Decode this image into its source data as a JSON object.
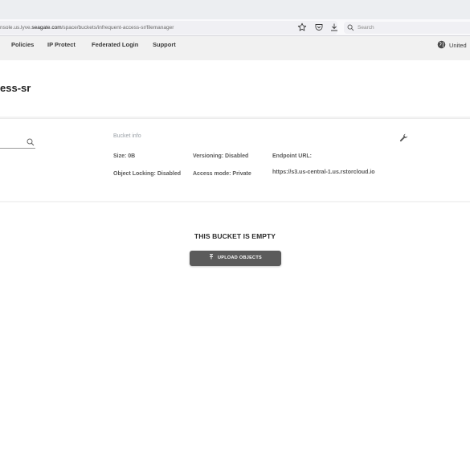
{
  "browser": {
    "url_prefix": "nsole.us.lyve.",
    "url_host": "seagate.com",
    "url_path": "/space/buckets/infrequent-access-sr/filemanager",
    "search_placeholder": "Search"
  },
  "nav": {
    "items": [
      {
        "label": "Policies"
      },
      {
        "label": "IP Protect"
      },
      {
        "label": "Federated Login"
      },
      {
        "label": "Support"
      }
    ],
    "region_label": "United"
  },
  "bucket": {
    "title": "ess-sr"
  },
  "info": {
    "heading": "Bucket info",
    "size": "Size: 0B",
    "versioning": "Versioning: Disabled",
    "endpoint_label": "Endpoint URL:",
    "object_locking": "Object Locking: Disabled",
    "access_mode": "Access mode: Private",
    "endpoint_url": "https://s3.us-central-1.us.rstorcloud.io"
  },
  "empty_state": {
    "title": "THIS BUCKET IS EMPTY",
    "upload_label": "UPLOAD OBJECTS"
  },
  "icons": {
    "star": "star-icon",
    "pocket": "pocket-icon",
    "download": "download-icon",
    "search": "search-icon",
    "globe": "globe-icon",
    "wrench": "wrench-icon",
    "upload": "upload-icon"
  }
}
